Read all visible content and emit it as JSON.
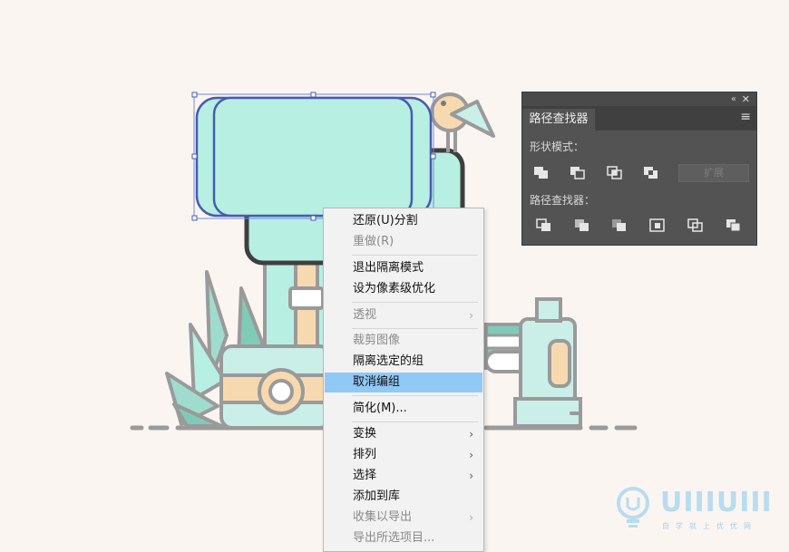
{
  "pathfinder": {
    "title": "路径查找器",
    "collapse_icon": "«",
    "close_icon": "✕",
    "menu_icon": "≡",
    "shape_modes_label": "形状模式：",
    "expand_label": "扩展",
    "pathfinders_label": "路径查找器："
  },
  "context_menu": {
    "items": [
      {
        "label": "还原(U)分割",
        "enabled": true
      },
      {
        "label": "重做(R)",
        "enabled": false
      },
      {
        "label": "退出隔离模式",
        "enabled": true
      },
      {
        "label": "设为像素级优化",
        "enabled": true
      },
      {
        "label": "透视",
        "enabled": false,
        "submenu": true
      },
      {
        "label": "裁剪图像",
        "enabled": false
      },
      {
        "label": "隔离选定的组",
        "enabled": true
      },
      {
        "label": "取消编组",
        "enabled": true,
        "highlighted": true
      },
      {
        "label": "简化(M)...",
        "enabled": true
      },
      {
        "label": "变换",
        "enabled": true,
        "submenu": true
      },
      {
        "label": "排列",
        "enabled": true,
        "submenu": true
      },
      {
        "label": "选择",
        "enabled": true,
        "submenu": true
      },
      {
        "label": "添加到库",
        "enabled": true
      },
      {
        "label": "收集以导出",
        "enabled": false,
        "submenu": true
      },
      {
        "label": "导出所选项目...",
        "enabled": false
      }
    ],
    "submenu_arrow": "›"
  },
  "watermark": {
    "brand": "UIIIUIII",
    "tagline": "自学就上优优网"
  },
  "colors": {
    "canvas_bg": "#fbf5f2",
    "mint": "#b7efe3",
    "outline": "#3f3f3f",
    "selection": "#4a5ab0",
    "highlight": "#90c8f6",
    "panel_bg": "#535353"
  }
}
